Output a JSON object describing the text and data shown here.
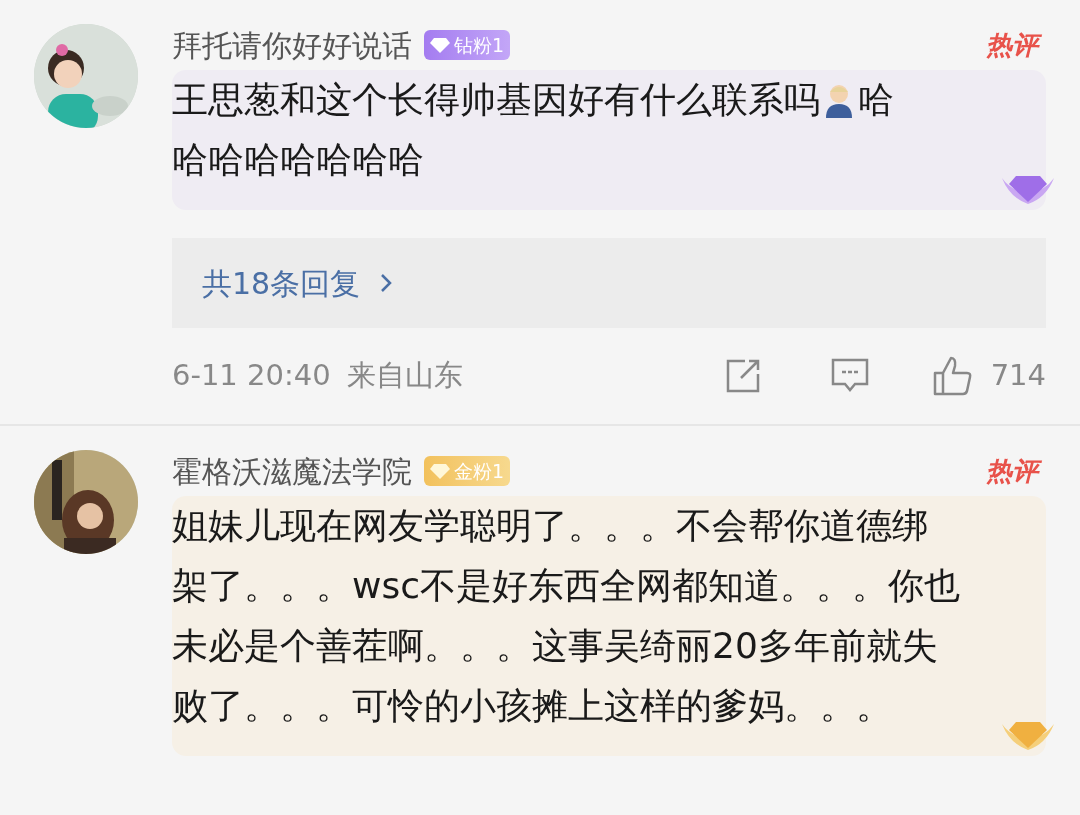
{
  "comments": [
    {
      "username": "拜托请你好好说话",
      "badge": {
        "kind": "diamond",
        "label": "钻粉1"
      },
      "tag": "热评",
      "text_lines": [
        [
          "王思葱和这个长得帅基因好有什么联系吗",
          "哈"
        ],
        [
          "哈哈哈哈哈哈哈"
        ]
      ],
      "replies": "共18条回复",
      "time": "6-11 20:40",
      "location": "来自山东",
      "likes": "714"
    },
    {
      "username": "霍格沃滋魔法学院",
      "badge": {
        "kind": "gold",
        "label": "金粉1"
      },
      "tag": "热评",
      "text_lines": [
        [
          "姐妹儿现在网友学聪明了。。。不会帮你道德绑"
        ],
        [
          "架了。。。wsc不是好东西全网都知道。。。你也"
        ],
        [
          "未必是个善茬啊。。。这事吴绮丽20多年前就失"
        ],
        [
          "败了。。。可怜的小孩摊上这样的爹妈。。。"
        ]
      ]
    }
  ]
}
